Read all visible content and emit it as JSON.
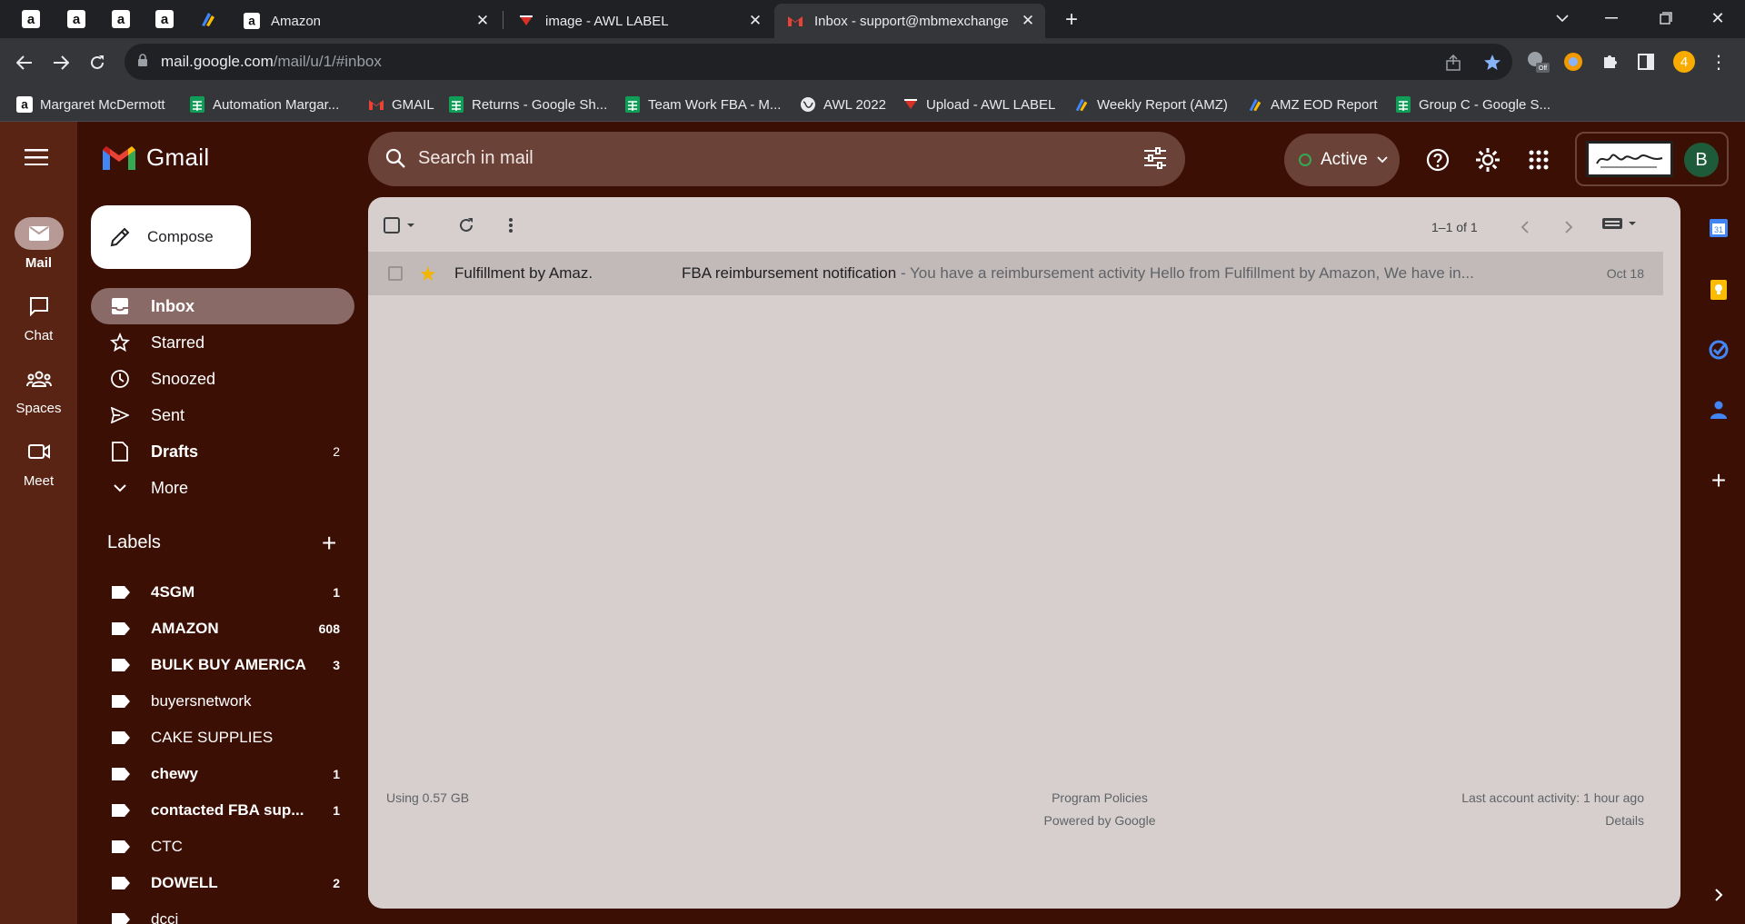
{
  "browser": {
    "tabs": [
      {
        "title": "Amazon"
      },
      {
        "title": "image - AWL LABEL"
      },
      {
        "title": "Inbox - support@mbmexchange"
      }
    ],
    "url_host": "mail.google.com",
    "url_path": "/mail/u/1/#inbox",
    "bookmarks": [
      {
        "label": "Margaret McDermott"
      },
      {
        "label": "Automation Margar..."
      },
      {
        "label": "GMAIL"
      },
      {
        "label": "Returns - Google Sh..."
      },
      {
        "label": "Team Work FBA - M..."
      },
      {
        "label": "AWL 2022"
      },
      {
        "label": "Upload - AWL LABEL"
      },
      {
        "label": "Weekly Report (AMZ)"
      },
      {
        "label": "AMZ EOD Report"
      },
      {
        "label": "Group C - Google S..."
      }
    ],
    "ext_badge": "4"
  },
  "gmail": {
    "brand": "Gmail",
    "rail": [
      {
        "label": "Mail"
      },
      {
        "label": "Chat"
      },
      {
        "label": "Spaces"
      },
      {
        "label": "Meet"
      }
    ],
    "compose_label": "Compose",
    "nav": [
      {
        "label": "Inbox",
        "count": ""
      },
      {
        "label": "Starred",
        "count": ""
      },
      {
        "label": "Snoozed",
        "count": ""
      },
      {
        "label": "Sent",
        "count": ""
      },
      {
        "label": "Drafts",
        "count": "2"
      },
      {
        "label": "More",
        "count": ""
      }
    ],
    "labels_heading": "Labels",
    "labels": [
      {
        "name": "4SGM",
        "count": "1"
      },
      {
        "name": "AMAZON",
        "count": "608"
      },
      {
        "name": "BULK BUY AMERICA",
        "count": "3"
      },
      {
        "name": "buyersnetwork",
        "count": ""
      },
      {
        "name": "CAKE SUPPLIES",
        "count": ""
      },
      {
        "name": "chewy",
        "count": "1"
      },
      {
        "name": "contacted FBA sup...",
        "count": "1"
      },
      {
        "name": "CTC",
        "count": ""
      },
      {
        "name": "DOWELL",
        "count": "2"
      },
      {
        "name": "dcci",
        "count": ""
      }
    ],
    "search_placeholder": "Search in mail",
    "status": "Active",
    "avatar_letter": "B",
    "pager_text": "1–1 of 1",
    "emails": [
      {
        "from": "Fulfillment by Amaz.",
        "subject": "FBA reimbursement notification",
        "snippet": " - You have a reimbursement activity Hello from Fulfillment by Amazon, We have in...",
        "date": "Oct 18",
        "starred": true
      }
    ],
    "footer": {
      "storage": "Using 0.57 GB",
      "policies": "Program Policies",
      "powered": "Powered by Google",
      "activity": "Last account activity: 1 hour ago",
      "details": "Details"
    },
    "calendar_day": "31"
  },
  "colors": {
    "theme_bg": "#3c0f05",
    "rail_bg": "#5a2414",
    "content_bg": "#d7cfcd",
    "star": "#f4b400"
  }
}
